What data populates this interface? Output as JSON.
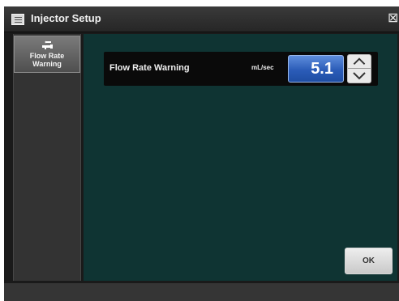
{
  "window": {
    "title": "Injector Setup",
    "close_glyph": "⊠",
    "title_icon": "list-icon",
    "close_icon": "close-icon"
  },
  "sidebar": {
    "items": [
      {
        "label": "Flow Rate Warning",
        "icon": "injector-syringe-icon",
        "selected": true
      }
    ]
  },
  "main": {
    "setting": {
      "label": "Flow Rate Warning",
      "unit": "mL/sec",
      "value": "5.1"
    },
    "ok_label": "OK"
  },
  "colors": {
    "content_background": "#0f3433",
    "value_accent": "#2b5cb8",
    "sidebar_selected": "#6a6a6a"
  }
}
